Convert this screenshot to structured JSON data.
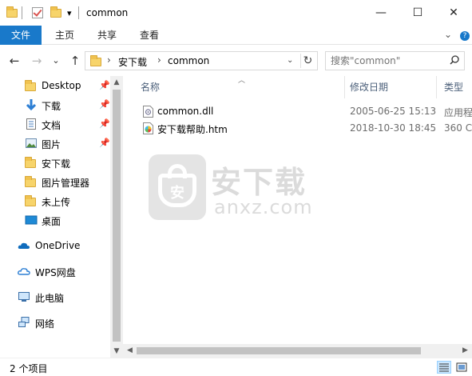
{
  "titlebar": {
    "title": "common",
    "dropdown_glyph": "▾",
    "minimize_glyph": "—",
    "maximize_glyph": "☐",
    "close_glyph": "✕"
  },
  "ribbon": {
    "tabs": [
      {
        "label": "文件",
        "active": true
      },
      {
        "label": "主页"
      },
      {
        "label": "共享"
      },
      {
        "label": "查看"
      }
    ],
    "expand_glyph": "⌄",
    "help_glyph": "?"
  },
  "navigation": {
    "back_glyph": "←",
    "forward_glyph": "→",
    "recent_glyph": "⌄",
    "up_glyph": "↑"
  },
  "address": {
    "crumbs": [
      "安下载",
      "common"
    ],
    "separator": "›",
    "refresh_glyph": "↻"
  },
  "search": {
    "placeholder": "搜索\"common\""
  },
  "nav_pane": {
    "items": [
      {
        "label": "Desktop",
        "icon": "folder-icon",
        "pinned": true
      },
      {
        "label": "下载",
        "icon": "download-arrow-icon",
        "pinned": true
      },
      {
        "label": "文档",
        "icon": "document-icon",
        "pinned": true
      },
      {
        "label": "图片",
        "icon": "picture-icon",
        "pinned": true
      },
      {
        "label": "安下载",
        "icon": "folder-icon"
      },
      {
        "label": "图片管理器",
        "icon": "folder-icon"
      },
      {
        "label": "未上传",
        "icon": "folder-icon"
      },
      {
        "label": "桌面",
        "icon": "desktop-icon"
      },
      {
        "label": "OneDrive",
        "icon": "cloud-icon"
      },
      {
        "label": "WPS网盘",
        "icon": "wps-cloud-icon"
      },
      {
        "label": "此电脑",
        "icon": "computer-icon"
      },
      {
        "label": "网络",
        "icon": "network-icon"
      }
    ],
    "pin_glyph": "📌"
  },
  "file_list": {
    "columns": {
      "name": "名称",
      "modified": "修改日期",
      "type": "类型"
    },
    "rows": [
      {
        "name": "common.dll",
        "modified": "2005-06-25 15:13",
        "type": "应用程",
        "icon": "dll-file-icon"
      },
      {
        "name": "安下载帮助.htm",
        "modified": "2018-10-30 18:45",
        "type": "360 C",
        "icon": "htm-file-icon"
      }
    ]
  },
  "watermark": {
    "cn": "安下载",
    "en": "anxz.com",
    "shield_glyph": "安"
  },
  "status": {
    "count_text": "2 个项目"
  },
  "colors": {
    "accent": "#1979ca",
    "folder": "#f7d46b",
    "header_text": "#4c607a"
  }
}
